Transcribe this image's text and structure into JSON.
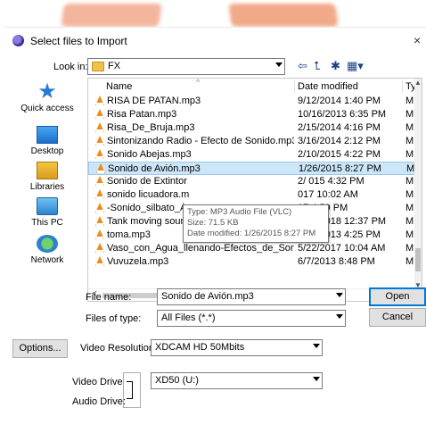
{
  "dialog": {
    "title": "Select files to Import",
    "close_glyph": "×"
  },
  "lookin": {
    "label": "Look in:",
    "value": "FX",
    "icon": "folder-icon"
  },
  "toolbar": {
    "back_icon": "back-arrow-icon",
    "up_icon": "up-folder-icon",
    "newfolder_icon": "new-folder-icon",
    "view_icon": "view-menu-icon"
  },
  "places": [
    {
      "label": "Quick access",
      "icon": "star-icon"
    },
    {
      "label": "Desktop",
      "icon": "desktop-icon"
    },
    {
      "label": "Libraries",
      "icon": "libraries-icon"
    },
    {
      "label": "This PC",
      "icon": "pc-icon"
    },
    {
      "label": "Network",
      "icon": "network-icon"
    }
  ],
  "columns": {
    "name": "Name",
    "date": "Date modified",
    "type": "Ty"
  },
  "files": [
    {
      "name": "RISA DE PATAN.mp3",
      "date": "9/12/2014 1:40 PM",
      "type": "M"
    },
    {
      "name": "Risa Patan.mp3",
      "date": "10/16/2013 6:35 PM",
      "type": "M"
    },
    {
      "name": "Risa_De_Bruja.mp3",
      "date": "2/15/2014 4:16 PM",
      "type": "M"
    },
    {
      "name": "Sintonizando Radio - Efecto de Sonido.mp3",
      "date": "3/16/2014 2:12 PM",
      "type": "M"
    },
    {
      "name": "Sonido Abejas.mp3",
      "date": "2/10/2015 4:22 PM",
      "type": "M"
    },
    {
      "name": "Sonido de Avión.mp3",
      "date": "1/26/2015 8:27 PM",
      "type": "M",
      "selected": true
    },
    {
      "name": "Sonido de Extintor",
      "date": "2/ 015 4:32 PM",
      "type": "M"
    },
    {
      "name": "sonido licuadora.m",
      "date": "017 10:02 AM",
      "type": "M"
    },
    {
      "name": "-Sonido_silbato_Á",
      "date": "17 4:59 PM",
      "type": "M"
    },
    {
      "name": "Tank moving sound effect 2.mp3",
      "date": "7/25/2018 12:37 PM",
      "type": "M"
    },
    {
      "name": "toma.mp3",
      "date": "8/28/2013 4:25 PM",
      "type": "M"
    },
    {
      "name": "Vaso_con_Agua_llenando-Efectos_de_Sonid...",
      "date": "5/22/2017 10:04 AM",
      "type": "M"
    },
    {
      "name": "Vuvuzela.mp3",
      "date": "6/7/2013 8:48 PM",
      "type": "M"
    }
  ],
  "tooltip": {
    "line1": "Type: MP3 Audio File (VLC)",
    "line2": "Size: 71.5 KB",
    "line3": "Date modified: 1/26/2015 8:27 PM"
  },
  "form": {
    "filename_label": "File name:",
    "filename_value": "Sonido de Avión.mp3",
    "filetype_label": "Files of type:",
    "filetype_value": "All Files (*.*)",
    "open": "Open",
    "cancel": "Cancel",
    "options": "Options...",
    "resolution_label": "Video Resolution:",
    "resolution_value": "XDCAM HD 50Mbits",
    "video_drive_label": "Video Drive:",
    "video_drive_value": "XD50 (U:)",
    "audio_drive_label": "Audio Drive:"
  },
  "colors": {
    "selection": "#cde6f7",
    "vlc_orange": "#f08b1a",
    "accent": "#0078d7"
  }
}
